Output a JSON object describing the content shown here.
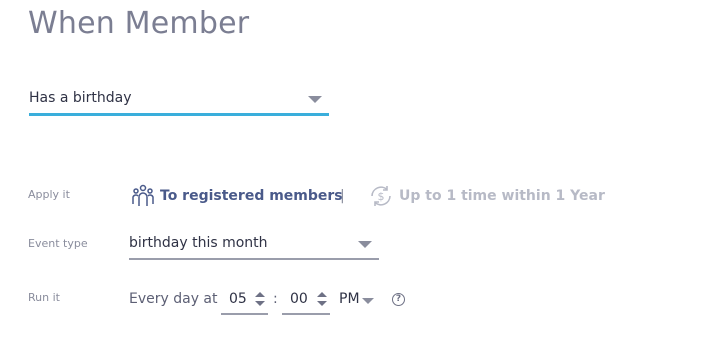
{
  "title": "When Member",
  "trigger": {
    "selected": "Has a birthday"
  },
  "apply": {
    "label": "Apply it",
    "registered_link": "To registered members",
    "separator": "|",
    "frequency_link": "Up to 1 time within 1 Year"
  },
  "event_type": {
    "label": "Event type",
    "selected": "birthday this month"
  },
  "run": {
    "label": "Run it",
    "prefix": "Every day at",
    "hour": "05",
    "colon": ":",
    "minute": "00",
    "ampm": "PM",
    "help": "?"
  },
  "icons": {
    "members": "people-group-icon",
    "recurrence": "recurring-dollar-icon",
    "help": "question-circle-icon"
  },
  "colors": {
    "accent": "#3aaedb",
    "title": "#7b7e92",
    "link": "#4a5a8a",
    "disabled_link": "#b7bac6"
  }
}
